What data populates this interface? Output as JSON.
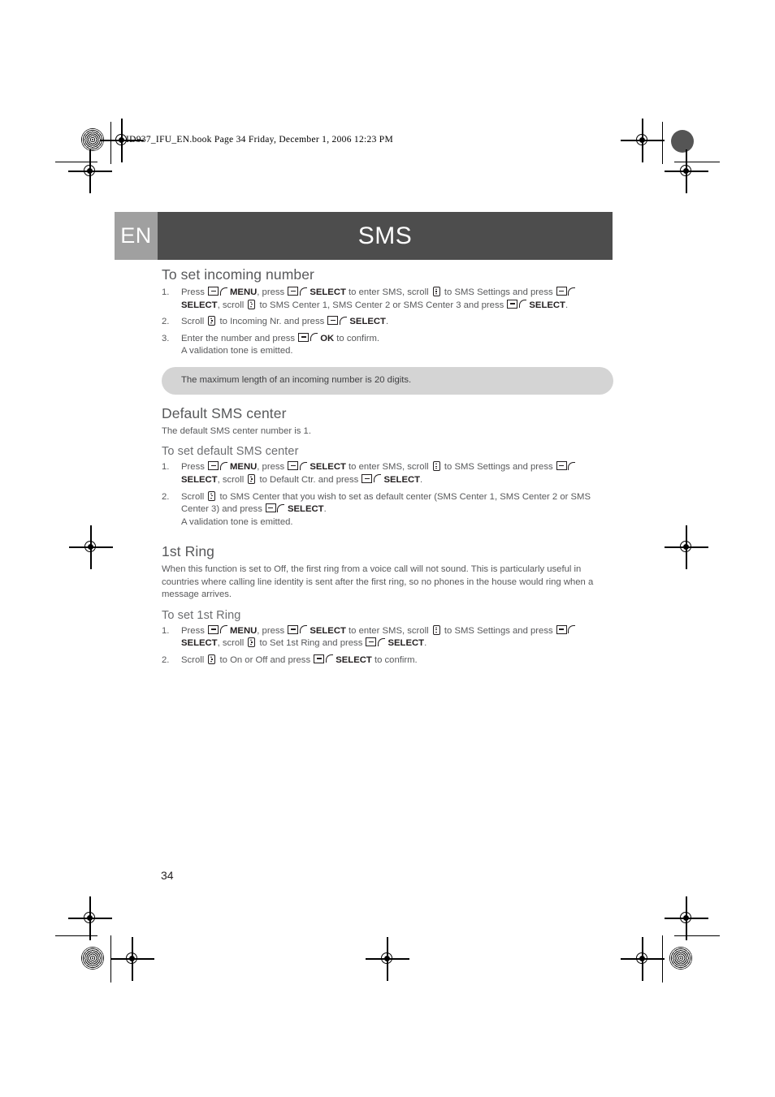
{
  "slug": {
    "text": "ID937_IFU_EN.book  Page 34  Friday, December 1, 2006  12:23 PM"
  },
  "header": {
    "language_badge": "EN",
    "title": "SMS",
    "badge_color": "#a0a0a0",
    "bar_color": "#4d4d4d"
  },
  "sections": [
    {
      "heading": "To set incoming number",
      "steps": [
        {
          "parts": [
            {
              "t": "text",
              "v": "Press "
            },
            {
              "t": "softkey"
            },
            {
              "t": "bold",
              "v": "MENU"
            },
            {
              "t": "text",
              "v": ", press "
            },
            {
              "t": "softkey"
            },
            {
              "t": "bold",
              "v": "SELECT"
            },
            {
              "t": "text",
              "v": " to enter SMS, scroll "
            },
            {
              "t": "scrollkey"
            },
            {
              "t": "text",
              "v": " to SMS Settings and press "
            },
            {
              "t": "softkey"
            },
            {
              "t": "bold",
              "v": "SELECT"
            },
            {
              "t": "text",
              "v": ", scroll "
            },
            {
              "t": "scrollkey"
            },
            {
              "t": "text",
              "v": " to SMS Center 1, SMS Center 2 or SMS Center 3 and press "
            },
            {
              "t": "softkey"
            },
            {
              "t": "bold",
              "v": "SELECT"
            },
            {
              "t": "text",
              "v": "."
            }
          ]
        },
        {
          "parts": [
            {
              "t": "text",
              "v": "Scroll "
            },
            {
              "t": "scrollkey"
            },
            {
              "t": "text",
              "v": " to Incoming Nr. and press "
            },
            {
              "t": "softkey"
            },
            {
              "t": "bold",
              "v": "SELECT"
            },
            {
              "t": "text",
              "v": "."
            }
          ]
        },
        {
          "parts": [
            {
              "t": "text",
              "v": "Enter the number and press "
            },
            {
              "t": "softkey"
            },
            {
              "t": "bold",
              "v": "OK"
            },
            {
              "t": "text",
              "v": " to confirm."
            },
            {
              "t": "br"
            },
            {
              "t": "text",
              "v": "A validation tone is emitted."
            }
          ]
        }
      ],
      "note": "The maximum length of an incoming number is 20 digits."
    },
    {
      "heading": "Default SMS center",
      "intro": "The default SMS center number is 1.",
      "subheading": "To set default SMS center",
      "steps": [
        {
          "parts": [
            {
              "t": "text",
              "v": "Press "
            },
            {
              "t": "softkey"
            },
            {
              "t": "bold",
              "v": "MENU"
            },
            {
              "t": "text",
              "v": ", press "
            },
            {
              "t": "softkey"
            },
            {
              "t": "bold",
              "v": "SELECT"
            },
            {
              "t": "text",
              "v": " to enter SMS, scroll "
            },
            {
              "t": "scrollkey"
            },
            {
              "t": "text",
              "v": " to SMS Settings and press "
            },
            {
              "t": "softkey"
            },
            {
              "t": "bold",
              "v": "SELECT"
            },
            {
              "t": "text",
              "v": ", scroll "
            },
            {
              "t": "scrollkey"
            },
            {
              "t": "text",
              "v": " to Default Ctr. and press "
            },
            {
              "t": "softkey"
            },
            {
              "t": "bold",
              "v": "SELECT"
            },
            {
              "t": "text",
              "v": "."
            }
          ]
        },
        {
          "parts": [
            {
              "t": "text",
              "v": "Scroll "
            },
            {
              "t": "scrollkey"
            },
            {
              "t": "text",
              "v": " to SMS Center that you wish to set as default center (SMS Center 1, SMS Center 2 or SMS Center 3) and press "
            },
            {
              "t": "softkey"
            },
            {
              "t": "bold",
              "v": "SELECT"
            },
            {
              "t": "text",
              "v": "."
            },
            {
              "t": "br"
            },
            {
              "t": "text",
              "v": "A validation tone is emitted."
            }
          ]
        }
      ]
    },
    {
      "heading": "1st Ring",
      "intro": "When this function is set to Off, the first ring from a voice call will not sound. This is particularly useful in countries where calling line identity is sent after the first ring, so no phones in the house would ring when a message arrives.",
      "subheading": "To set 1st Ring",
      "steps": [
        {
          "parts": [
            {
              "t": "text",
              "v": "Press "
            },
            {
              "t": "softkey"
            },
            {
              "t": "bold",
              "v": "MENU"
            },
            {
              "t": "text",
              "v": ", press "
            },
            {
              "t": "softkey"
            },
            {
              "t": "bold",
              "v": "SELECT"
            },
            {
              "t": "text",
              "v": " to enter SMS, scroll "
            },
            {
              "t": "scrollkey"
            },
            {
              "t": "text",
              "v": " to SMS Settings and press "
            },
            {
              "t": "softkey"
            },
            {
              "t": "bold",
              "v": "SELECT"
            },
            {
              "t": "text",
              "v": ", scroll "
            },
            {
              "t": "scrollkey"
            },
            {
              "t": "text",
              "v": " to Set 1st Ring and press "
            },
            {
              "t": "softkey"
            },
            {
              "t": "bold",
              "v": "SELECT"
            },
            {
              "t": "text",
              "v": "."
            }
          ]
        },
        {
          "parts": [
            {
              "t": "text",
              "v": "Scroll "
            },
            {
              "t": "scrollkey"
            },
            {
              "t": "text",
              "v": " to On or Off and press "
            },
            {
              "t": "softkey"
            },
            {
              "t": "bold",
              "v": "SELECT"
            },
            {
              "t": "text",
              "v": " to confirm."
            }
          ]
        }
      ]
    }
  ],
  "footer": {
    "page_number": "34"
  },
  "icons": {
    "softkey": "softkey-icon",
    "scrollkey": "scroll-updown-icon",
    "registration": "registration-target-icon",
    "halftone": "halftone-density-icon"
  }
}
